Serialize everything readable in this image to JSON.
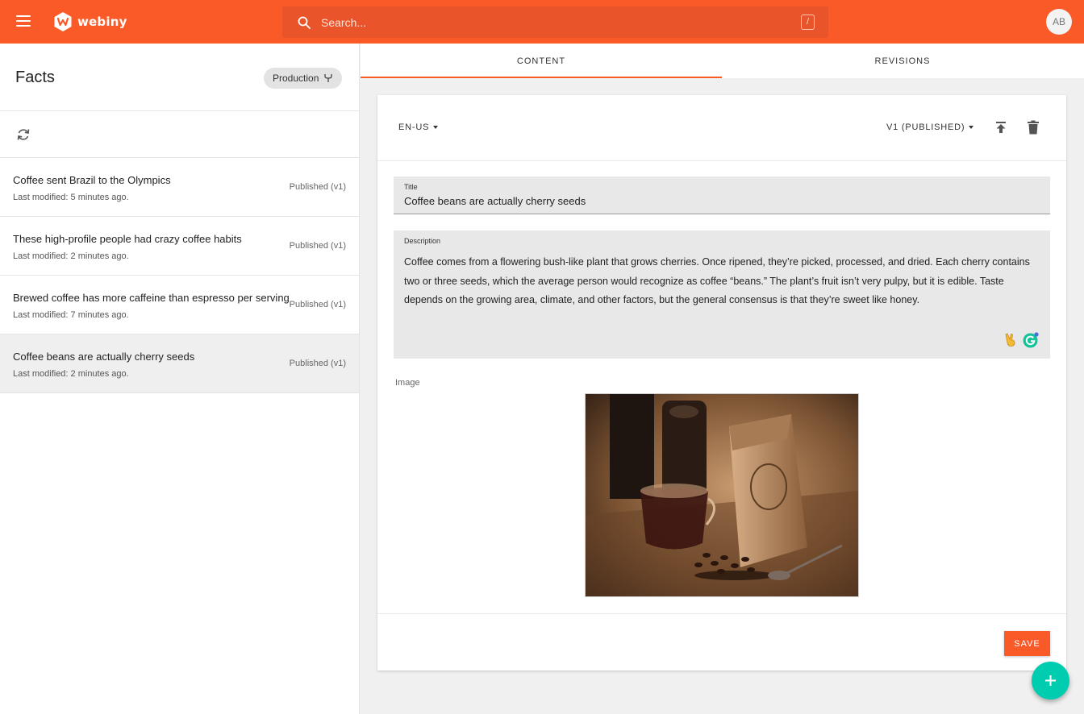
{
  "app": {
    "name": "webiny",
    "accent": "#fa5a28",
    "fab_color": "#00ccb0"
  },
  "header": {
    "menu_icon": "hamburger-icon",
    "search_placeholder": "Search...",
    "search_shortcut": "/",
    "user_initials": "AB"
  },
  "sidebar": {
    "title": "Facts",
    "environment": "Production",
    "entries": [
      {
        "title": "Coffee sent Brazil to the Olympics",
        "modified": "Last modified: 5 minutes ago.",
        "status": "Published (v1)"
      },
      {
        "title": "These high-profile people had crazy coffee habits",
        "modified": "Last modified: 2 minutes ago.",
        "status": "Published (v1)"
      },
      {
        "title": "Brewed coffee has more caffeine than espresso per serving",
        "modified": "Last modified: 7 minutes ago.",
        "status": "Published (v1)"
      },
      {
        "title": "Coffee beans are actually cherry seeds",
        "modified": "Last modified: 2 minutes ago.",
        "status": "Published (v1)",
        "selected": true
      }
    ]
  },
  "tabs": [
    {
      "label": "CONTENT",
      "active": true
    },
    {
      "label": "REVISIONS",
      "active": false
    }
  ],
  "editor": {
    "locale": "EN-US",
    "version": "V1 (PUBLISHED)",
    "title_label": "Title",
    "title_value": "Coffee beans are actually cherry seeds",
    "description_label": "Description",
    "description_value": "Coffee comes from a flowering bush-like plant that grows cherries. Once ripened, they’re picked, processed, and dried. Each cherry contains two or three seeds, which the average person would recognize as coffee “beans.” The plant’s fruit isn’t very pulpy, but it is edible. Taste depends on the growing area, climate, and other factors, but the general consensus is that they’re sweet like honey.",
    "image_label": "Image",
    "save_label": "SAVE"
  }
}
